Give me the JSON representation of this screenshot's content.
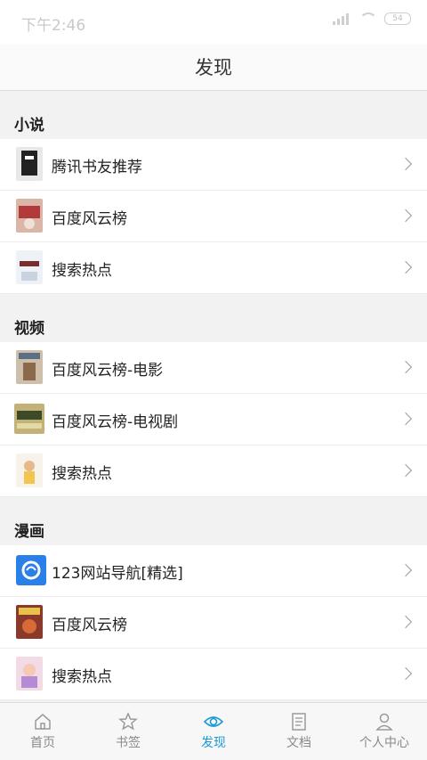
{
  "status": {
    "time": "下午2:46",
    "battery": "54"
  },
  "header": {
    "title": "发现"
  },
  "sections": [
    {
      "title": "小说",
      "items": [
        {
          "label": "腾讯书友推荐"
        },
        {
          "label": "百度风云榜"
        },
        {
          "label": "搜索热点"
        }
      ]
    },
    {
      "title": "视频",
      "items": [
        {
          "label": "百度风云榜-电影"
        },
        {
          "label": "百度风云榜-电视剧"
        },
        {
          "label": "搜索热点"
        }
      ]
    },
    {
      "title": "漫画",
      "items": [
        {
          "label": "123网站导航[精选]"
        },
        {
          "label": "百度风云榜"
        },
        {
          "label": "搜索热点"
        }
      ]
    }
  ],
  "tabs": [
    {
      "label": "首页",
      "icon": "home-icon"
    },
    {
      "label": "书签",
      "icon": "star-icon"
    },
    {
      "label": "发现",
      "icon": "eye-icon"
    },
    {
      "label": "文档",
      "icon": "document-icon"
    },
    {
      "label": "个人中心",
      "icon": "user-icon"
    }
  ],
  "colors": {
    "accent": "#1a9bd7",
    "background": "#f2f2f2"
  }
}
